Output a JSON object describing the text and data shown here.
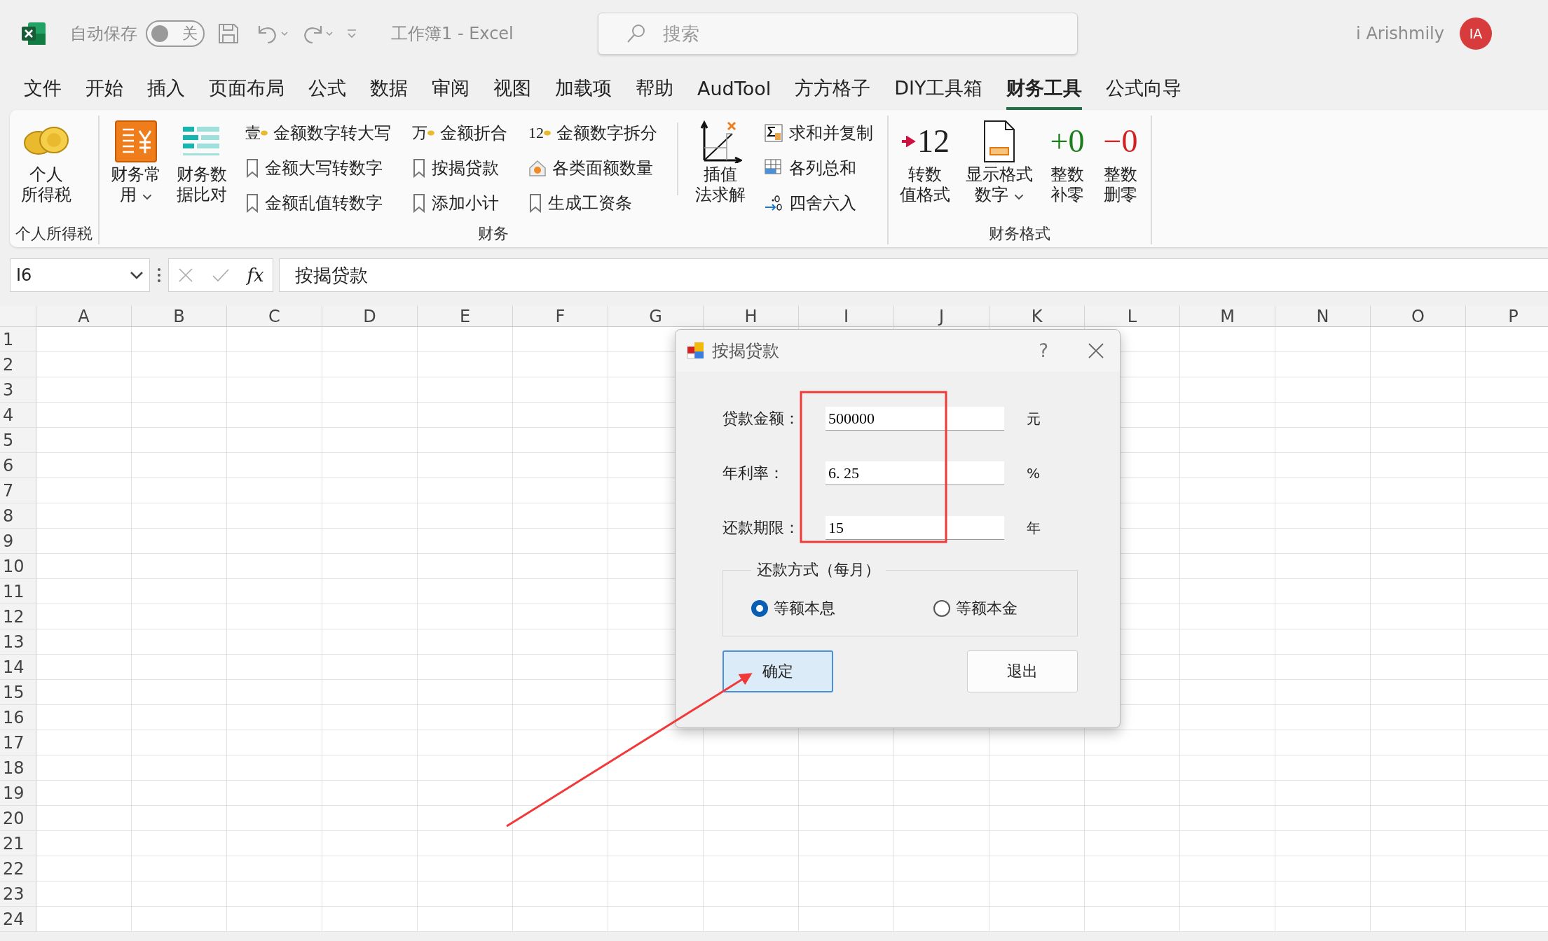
{
  "title_bar": {
    "autosave_label": "自动保存",
    "autosave_toggle": {
      "on": false,
      "label": "关"
    },
    "document_title": "工作簿1  -  Excel",
    "search": {
      "placeholder": "搜索"
    },
    "user_name": "i Arishmily",
    "avatar_initials": "IA"
  },
  "menu_tabs": [
    {
      "label": "文件",
      "selected": false
    },
    {
      "label": "开始",
      "selected": false
    },
    {
      "label": "插入",
      "selected": false
    },
    {
      "label": "页面布局",
      "selected": false
    },
    {
      "label": "公式",
      "selected": false
    },
    {
      "label": "数据",
      "selected": false
    },
    {
      "label": "审阅",
      "selected": false
    },
    {
      "label": "视图",
      "selected": false
    },
    {
      "label": "加载项",
      "selected": false
    },
    {
      "label": "帮助",
      "selected": false
    },
    {
      "label": "AudTool",
      "selected": false
    },
    {
      "label": "方方格子",
      "selected": false
    },
    {
      "label": "DIY工具箱",
      "selected": false
    },
    {
      "label": "财务工具",
      "selected": true
    },
    {
      "label": "公式向导",
      "selected": false
    }
  ],
  "ribbon": {
    "groups": [
      {
        "title": "个人所得税",
        "items": [
          {
            "kind": "large",
            "lines": [
              "个人",
              "所得税"
            ],
            "dropdown": false
          }
        ]
      },
      {
        "title": "财务",
        "items": [
          {
            "kind": "large",
            "lines": [
              "财务常",
              "用"
            ],
            "dropdown": true
          },
          {
            "kind": "large",
            "lines": [
              "财务数",
              "据比对"
            ],
            "dropdown": false
          },
          {
            "kind": "stack",
            "buttons": [
              {
                "label": "金额数字转大写",
                "icon_text": "壹"
              },
              {
                "label": "金额大写转数字"
              },
              {
                "label": "金额乱值转数字"
              }
            ]
          },
          {
            "kind": "stack",
            "buttons": [
              {
                "label": "金额折合",
                "icon_text": "万"
              },
              {
                "label": "按揭贷款"
              },
              {
                "label": "添加小计"
              }
            ]
          },
          {
            "kind": "stack",
            "buttons": [
              {
                "label": "金额数字拆分",
                "icon_text": "12"
              },
              {
                "label": "各类面额数量"
              },
              {
                "label": "生成工资条"
              }
            ]
          },
          {
            "kind": "separator"
          },
          {
            "kind": "large",
            "lines": [
              "插值",
              "法求解"
            ],
            "dropdown": false
          },
          {
            "kind": "stack",
            "buttons": [
              {
                "label": "求和并复制"
              },
              {
                "label": "各列总和"
              },
              {
                "label": "四舍六入"
              }
            ]
          }
        ]
      },
      {
        "title": "财务格式",
        "items": [
          {
            "kind": "large",
            "lines": [
              "转数",
              "值格式"
            ],
            "icon_text": "12",
            "dropdown": false
          },
          {
            "kind": "large",
            "lines": [
              "显示格式",
              "数字"
            ],
            "dropdown": true
          },
          {
            "kind": "large",
            "lines": [
              "整数",
              "补零"
            ],
            "icon_text": "+0",
            "dropdown": false
          },
          {
            "kind": "large",
            "lines": [
              "整数",
              "删零"
            ],
            "icon_text": "−0",
            "dropdown": false
          }
        ]
      }
    ]
  },
  "formula_bar": {
    "name_box": "I6",
    "function_label": "fx",
    "content": "按揭贷款"
  },
  "sheet": {
    "columns": [
      "A",
      "B",
      "C",
      "D",
      "E",
      "F",
      "G",
      "H",
      "I",
      "J",
      "K",
      "L",
      "M",
      "N",
      "O",
      "P"
    ],
    "rows": [
      "1",
      "2",
      "3",
      "4",
      "5",
      "6",
      "7",
      "8",
      "9",
      "10",
      "11",
      "12",
      "13",
      "14",
      "15",
      "16",
      "17",
      "18",
      "19",
      "20",
      "21",
      "22",
      "23",
      "24"
    ]
  },
  "dialog": {
    "title": "按揭贷款",
    "help": "?",
    "fields": [
      {
        "label": "贷款金额：",
        "value": "500000",
        "unit": "元"
      },
      {
        "label": "年利率：",
        "value": "6. 25",
        "unit": "%"
      },
      {
        "label": "还款期限：",
        "value": "15",
        "unit": "年"
      }
    ],
    "payment_group": {
      "title": "还款方式（每月）",
      "options": [
        {
          "label": "等额本息",
          "selected": true
        },
        {
          "label": "等额本金",
          "selected": false
        }
      ]
    },
    "buttons": [
      {
        "label": "确定",
        "kind": "primary"
      },
      {
        "label": "退出",
        "kind": "default"
      }
    ]
  },
  "annotations": [
    {
      "kind": "box"
    },
    {
      "kind": "arrow"
    }
  ]
}
